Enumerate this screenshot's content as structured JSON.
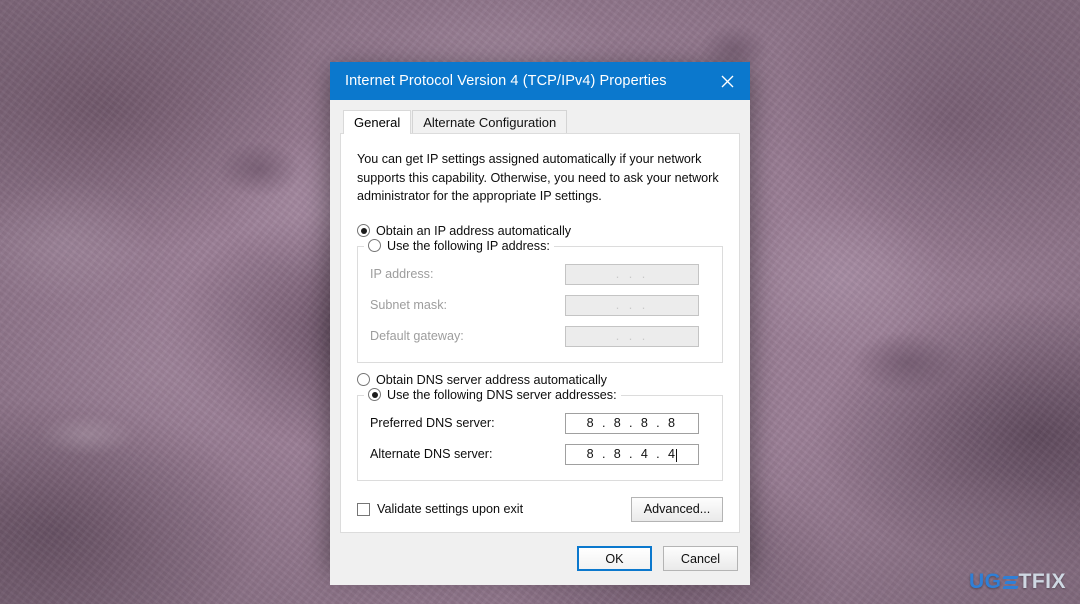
{
  "window": {
    "title": "Internet Protocol Version 4 (TCP/IPv4) Properties",
    "close_label": "✕",
    "titlebar_color": "#0b78cd"
  },
  "tabs": [
    {
      "label": "General",
      "active": true
    },
    {
      "label": "Alternate Configuration",
      "active": false
    }
  ],
  "general": {
    "intro": "You can get IP settings assigned automatically if your network supports this capability. Otherwise, you need to ask your network administrator for the appropriate IP settings.",
    "ip_mode": {
      "auto_label": "Obtain an IP address automatically",
      "manual_label": "Use the following IP address:",
      "selected": "auto"
    },
    "ip_fields": [
      {
        "label": "IP address:",
        "value": ".    .    .",
        "disabled": true
      },
      {
        "label": "Subnet mask:",
        "value": ".    .    .",
        "disabled": true
      },
      {
        "label": "Default gateway:",
        "value": ".    .    .",
        "disabled": true
      }
    ],
    "dns_mode": {
      "auto_label": "Obtain DNS server address automatically",
      "manual_label": "Use the following DNS server addresses:",
      "selected": "manual"
    },
    "dns_fields": [
      {
        "label": "Preferred DNS server:",
        "value": "8 . 8 . 8 . 8",
        "disabled": false,
        "caret": false
      },
      {
        "label": "Alternate DNS server:",
        "value": "8 . 8 . 4 . 4",
        "disabled": false,
        "caret": true
      }
    ],
    "validate_checkbox": {
      "label": "Validate settings upon exit",
      "checked": false
    },
    "advanced_label": "Advanced..."
  },
  "footer": {
    "ok_label": "OK",
    "cancel_label": "Cancel"
  },
  "watermark": {
    "prefix": "UG",
    "suffix": "TFIX",
    "accent_color": "#2f7fd6"
  }
}
